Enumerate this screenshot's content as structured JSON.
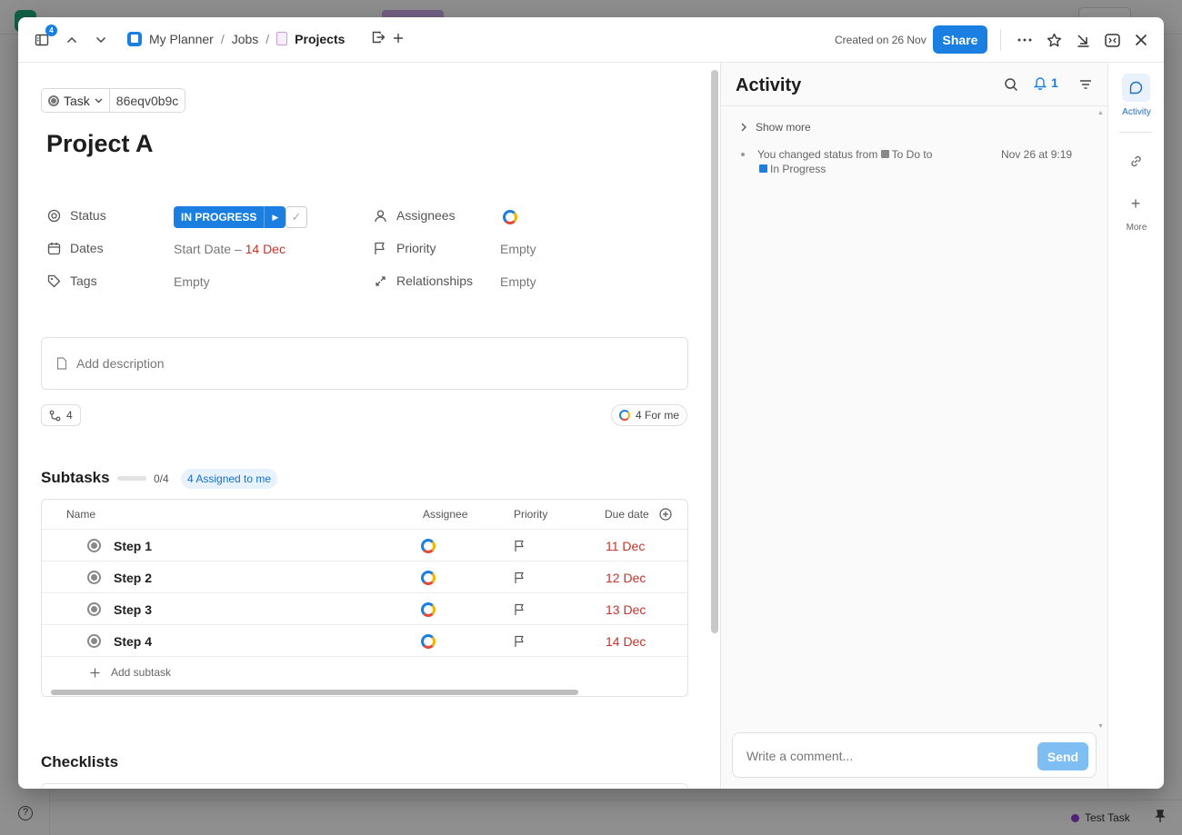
{
  "header": {
    "notif_count": "4",
    "breadcrumb": [
      "My Planner",
      "Jobs",
      "Projects"
    ],
    "created": "Created on 26 Nov",
    "share_label": "Share"
  },
  "task": {
    "type_label": "Task",
    "id": "86eqv0b9c",
    "title": "Project A"
  },
  "props": {
    "status_label": "Status",
    "status_value": "IN PROGRESS",
    "dates_label": "Dates",
    "dates_start": "Start Date",
    "dates_dash": " – ",
    "dates_due": "14 Dec",
    "tags_label": "Tags",
    "tags_value": "Empty",
    "assignees_label": "Assignees",
    "priority_label": "Priority",
    "priority_value": "Empty",
    "relationships_label": "Relationships",
    "relationships_value": "Empty"
  },
  "description": {
    "placeholder": "Add description"
  },
  "chips": {
    "subtask_count": "4",
    "for_me": "4 For me"
  },
  "subtasks": {
    "title": "Subtasks",
    "progress": 0,
    "progress_text": "0/4",
    "assigned_label": "4 Assigned to me",
    "columns": [
      "Name",
      "Assignee",
      "Priority",
      "Due date"
    ],
    "rows": [
      {
        "name": "Step 1",
        "due": "11 Dec"
      },
      {
        "name": "Step 2",
        "due": "12 Dec"
      },
      {
        "name": "Step 3",
        "due": "13 Dec"
      },
      {
        "name": "Step 4",
        "due": "14 Dec"
      }
    ],
    "add_label": "Add subtask"
  },
  "checklists": {
    "title": "Checklists"
  },
  "activity": {
    "title": "Activity",
    "bell_count": "1",
    "show_more": "Show more",
    "event": {
      "text_prefix": "You changed status from",
      "from_status": "To Do",
      "to_word": "to",
      "to_status": "In Progress",
      "time": "Nov 26 at 9:19"
    },
    "comment_placeholder": "Write a comment...",
    "send_label": "Send"
  },
  "rail": {
    "activity_label": "Activity",
    "more_label": "More"
  },
  "background": {
    "bottom_task": "Test Task"
  },
  "colors": {
    "accent": "#1a7fe0",
    "due_red": "#c0362c"
  }
}
